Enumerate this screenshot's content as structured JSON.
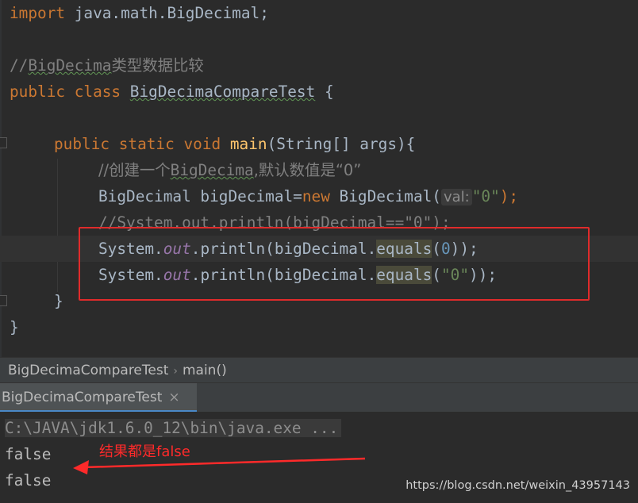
{
  "editor": {
    "line1": {
      "kw": "import",
      "rest": " java.math.BigDecimal;"
    },
    "line2_comment_a": "//",
    "line2_comment_b": "BigDecima",
    "line2_comment_c": "类型数据比较",
    "line3": {
      "kw1": "public",
      "kw2": "class",
      "class_name": "BigDecimaCompareTest",
      "brace": " {"
    },
    "line4": {
      "kw1": "public",
      "kw2": "static",
      "kw3": "void",
      "fn": "main",
      "params": "(String[] args){"
    },
    "line5_comment_a": "//创建一个",
    "line5_comment_b": "BigDecima",
    "line5_comment_c": ",默认数值是“0”",
    "line6": {
      "type": "BigDecimal",
      "var": " bigDecimal=",
      "kw": "new",
      "ctor": " BigDecimal(",
      "hint": "val:",
      "str": "\"0\"",
      "end": ");"
    },
    "line7_comment": "//System.out.println(bigDecimal==\"0\");",
    "line8": {
      "sys": "System.",
      "out": "out",
      "mid": ".println(bigDecimal.",
      "method": "equals",
      "open": "(",
      "num": "0",
      "close": "));"
    },
    "line9": {
      "sys": "System.",
      "out": "out",
      "mid": ".println(bigDecimal.",
      "method": "equals",
      "open": "(",
      "str": "\"0\"",
      "close": "));"
    },
    "line10": "}",
    "line11": "}"
  },
  "breadcrumb": {
    "class": "BigDecimaCompareTest",
    "sep": "›",
    "method": "main()"
  },
  "run_tab": {
    "label": "BigDecimaCompareTest",
    "close": "×"
  },
  "console": {
    "command": "C:\\JAVA\\jdk1.6.0_12\\bin\\java.exe ...",
    "output": [
      "false",
      "false"
    ]
  },
  "annotation": "结果都是false",
  "watermark": "https://blog.csdn.net/weixin_43957143",
  "colors": {
    "keyword": "#cc7832",
    "comment": "#808080",
    "string": "#6a8759",
    "number": "#6897bb",
    "annotation": "#ff2a2a"
  }
}
